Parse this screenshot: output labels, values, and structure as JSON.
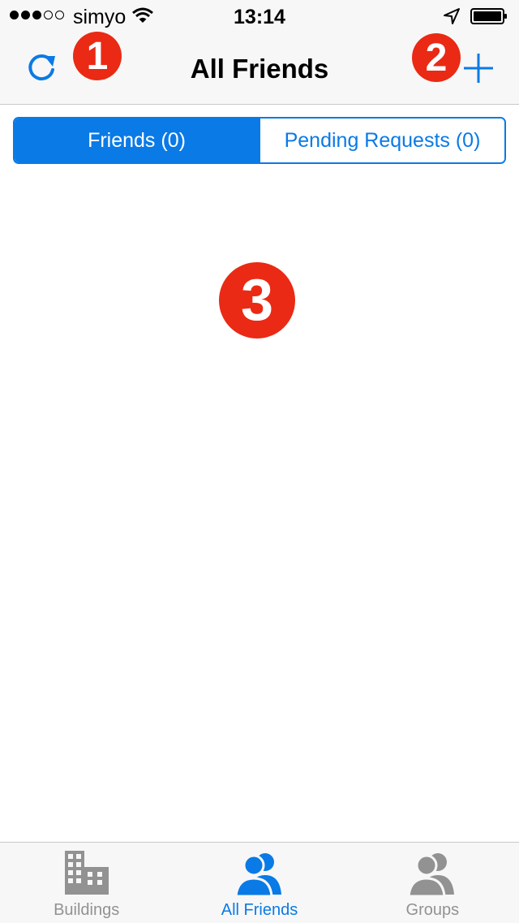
{
  "status_bar": {
    "carrier": "simyo",
    "time": "13:14",
    "signal_dots_filled": 3,
    "signal_dots_total": 5
  },
  "nav_bar": {
    "title": "All Friends",
    "left_icon": "refresh-icon",
    "right_icon": "plus-icon"
  },
  "annotations": {
    "marker_1": "1",
    "marker_2": "2",
    "marker_3": "3"
  },
  "segmented_control": {
    "segments": [
      {
        "label": "Friends (0)",
        "selected": true
      },
      {
        "label": "Pending Requests (0)",
        "selected": false
      }
    ]
  },
  "tab_bar": {
    "tabs": [
      {
        "label": "Buildings",
        "icon": "buildings-icon",
        "selected": false
      },
      {
        "label": "All Friends",
        "icon": "friends-icon",
        "selected": true
      },
      {
        "label": "Groups",
        "icon": "groups-icon",
        "selected": false
      }
    ]
  },
  "colors": {
    "accent": "#0a7ae6",
    "marker": "#ea2a14",
    "inactive_tab": "#929292"
  }
}
